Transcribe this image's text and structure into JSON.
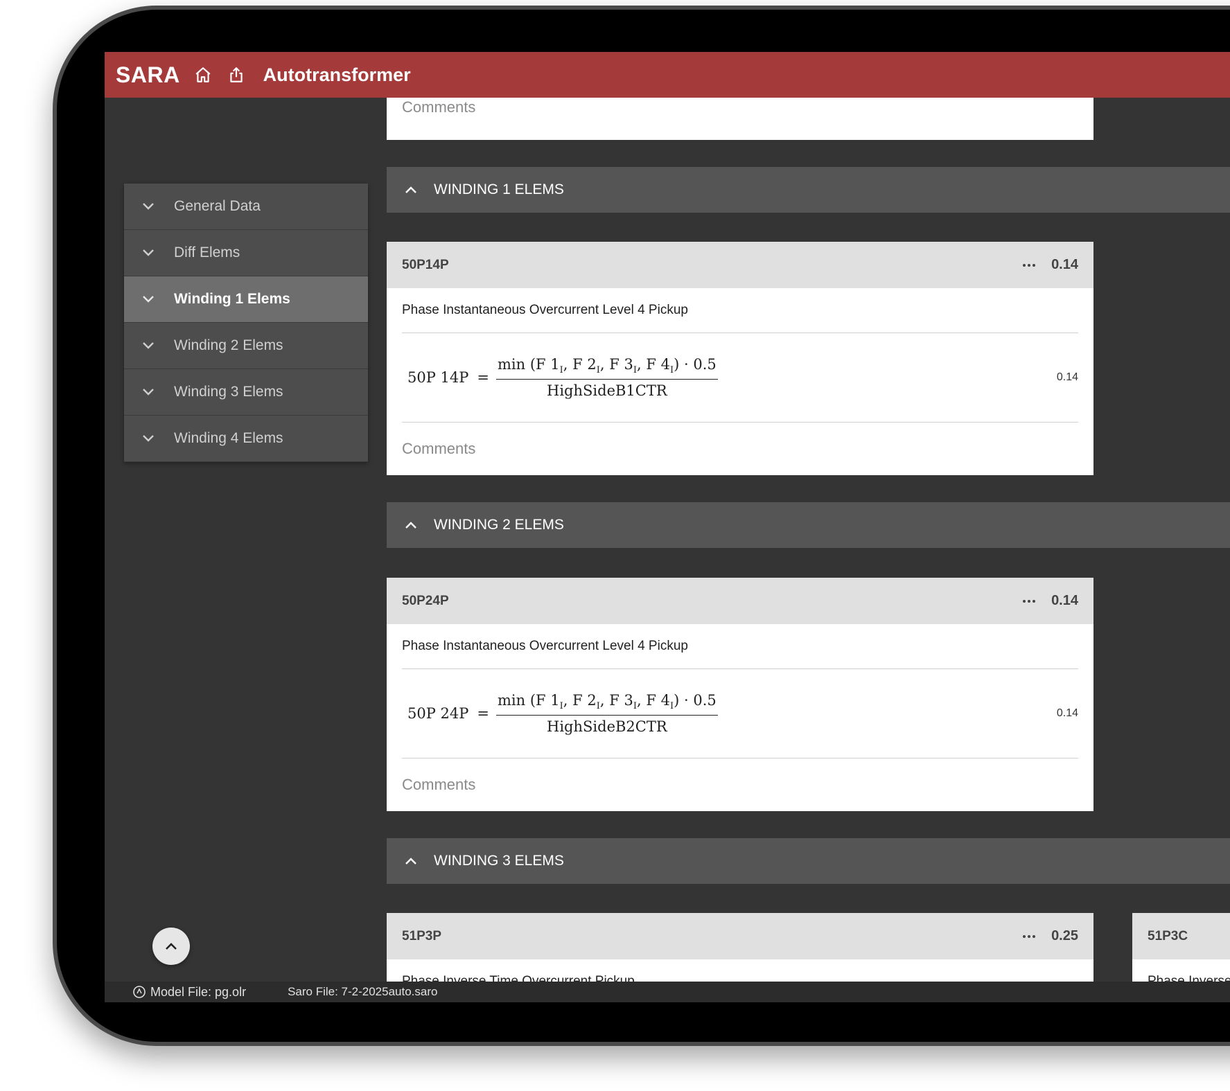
{
  "app": {
    "brand": "SARA",
    "title": "Autotransformer"
  },
  "sidebar": {
    "items": [
      {
        "label": "General Data",
        "active": false
      },
      {
        "label": "Diff Elems",
        "active": false
      },
      {
        "label": "Winding 1 Elems",
        "active": true
      },
      {
        "label": "Winding 2 Elems",
        "active": false
      },
      {
        "label": "Winding 3 Elems",
        "active": false
      },
      {
        "label": "Winding 4 Elems",
        "active": false
      }
    ]
  },
  "main": {
    "top_comments": "Comments",
    "sections": [
      {
        "title": "WINDING 1 ELEMS"
      },
      {
        "title": "WINDING 2 ELEMS"
      },
      {
        "title": "WINDING 3 ELEMS"
      }
    ],
    "cards": [
      {
        "name": "50P14P",
        "value": "0.14",
        "description": "Phase Instantaneous Overcurrent Level 4 Pickup",
        "eq_lhs": "50P 14P",
        "eq_num": "min (F 1",
        "eq_den": "HighSideB1CTR",
        "eq_value": "0.14",
        "comments": "Comments"
      },
      {
        "name": "50P24P",
        "value": "0.14",
        "description": "Phase Instantaneous Overcurrent Level 4 Pickup",
        "eq_lhs": "50P 24P",
        "eq_den": "HighSideB2CTR",
        "eq_value": "0.14",
        "comments": "Comments"
      },
      {
        "name": "51P3P",
        "value": "0.25",
        "description": "Phase Inverse Time Overcurrent Pickup"
      },
      {
        "name": "51P3C",
        "description": "Phase Inverse"
      }
    ]
  },
  "status": {
    "model_file": "Model File: pg.olr",
    "saro_file": "Saro File: 7-2-2025auto.saro"
  },
  "colors": {
    "accent": "#a53a3a",
    "background": "#343434",
    "section": "#555555"
  },
  "icons": [
    "home-icon",
    "share-icon",
    "chevron-down-icon",
    "chevron-up-icon",
    "more-horiz-icon",
    "model-file-icon"
  ]
}
